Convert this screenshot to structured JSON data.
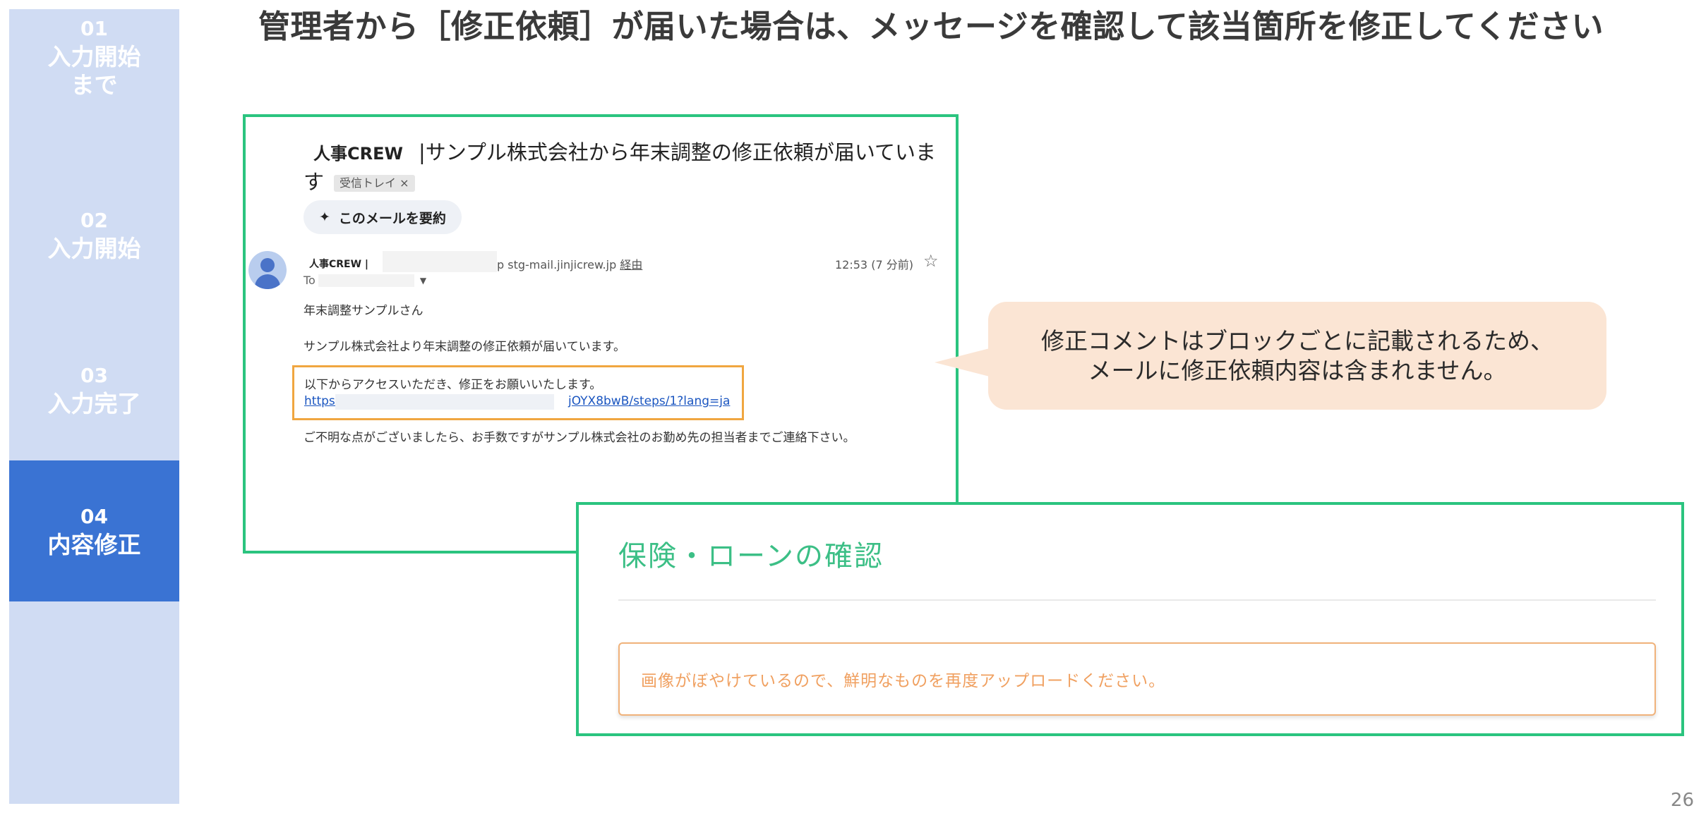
{
  "sidebar": {
    "steps": [
      {
        "num": "01",
        "label_lines": [
          "入力開始",
          "まで"
        ]
      },
      {
        "num": "02",
        "label": "入力開始"
      },
      {
        "num": "03",
        "label": "入力完了"
      },
      {
        "num": "04",
        "label": "内容修正",
        "active": true
      }
    ],
    "active_color": "#3a73d3",
    "bg_color": "#d0dcf3"
  },
  "heading": "管理者から［修正依頼］が届いた場合は、メッセージを確認して該当箇所を修正してください",
  "email": {
    "subject_brand": "人事CREW",
    "subject_text": "|サンプル株式会社から年末調整の修正依頼が届いています",
    "inbox_badge": "受信トレイ ×",
    "summary_button": "このメールを要約",
    "sender_name": "人事CREW |",
    "via_prefix": "p stg-mail.jinjicrew.jp",
    "via_link": "経由",
    "time": "12:53 (7 分前)",
    "to_label": "To",
    "greeting": "年末調整サンプルさん",
    "intro": "サンプル株式会社より年末調整の修正依頼が届いています。",
    "link_text": "以下からアクセスいただき、修正をお願いいたします。",
    "link_prefix": "https://",
    "link_tail": "jOYX8bwB/steps/1?lang=ja",
    "outro": "ご不明な点がございましたら、お手数ですがサンプル株式会社のお勤め先の担当者までご連絡下さい。"
  },
  "callout": {
    "line1": "修正コメントはブロックごとに記載されるため、",
    "line2": "メールに修正依頼内容は含まれません。"
  },
  "insurance": {
    "title": "保険・ローンの確認",
    "comment": "画像がぼやけているので、鮮明なものを再度アップロードください。"
  },
  "page_number": "26",
  "colors": {
    "highlight_border": "#2bc47f",
    "link_box_border": "#f0a640",
    "callout_bg": "#fbe5d4",
    "insurance_title": "#3cbf86",
    "comment_text": "#f0a060"
  }
}
